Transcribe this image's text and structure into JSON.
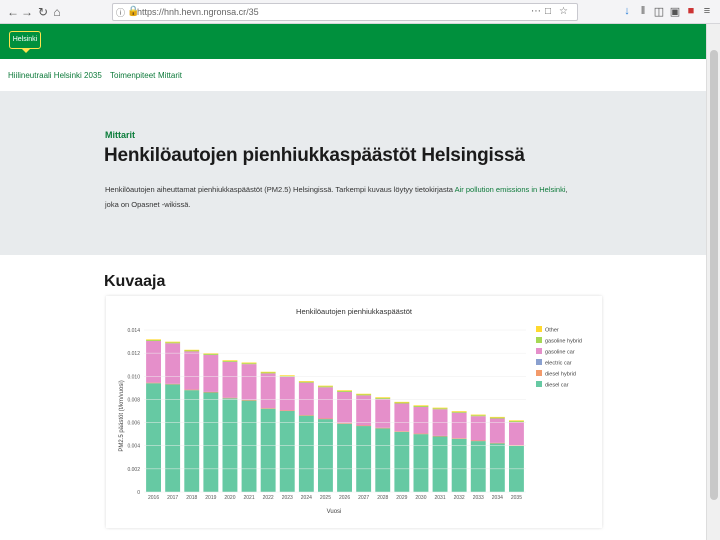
{
  "browser": {
    "url": "https://hnh.hevn.ngronsa.cr/35",
    "back_icon": "arrow-left",
    "forward_icon": "arrow-right",
    "reload_icon": "reload",
    "home_icon": "home"
  },
  "header": {
    "logo_text": "Helsinki",
    "brand_color": "#00903d",
    "logo_color": "#ffe34d"
  },
  "subnav": {
    "items": [
      "Hiilineutraali Helsinki 2035",
      "Toimenpiteet",
      "Mittarit"
    ]
  },
  "hero": {
    "eyebrow": "Mittarit",
    "title": "Henkilöautojen pienhiukkaspäästöt Helsingissä",
    "lead_before": "Henkilöautojen aiheuttamat pienhiukkaspäästöt (PM2.5) Helsingissä. Tarkempi kuvaus löytyy tietokirjasta ",
    "lead_link": "Air pollution emissions in Helsinki",
    "lead_after": ", joka on Opasnet -wikissä."
  },
  "section": {
    "title": "Kuvaaja"
  },
  "chart_data": {
    "type": "bar",
    "title": "Henkilöautojen pienhiukkaspäästöt",
    "xlabel": "Vuosi",
    "ylabel": "PM2.5 päästöt (t/km/vuosi)",
    "ylim": [
      0,
      0.014
    ],
    "yticks": [
      "0",
      "0.002",
      "0.004",
      "0.006",
      "0.008",
      "0.010",
      "0.012",
      "0.014"
    ],
    "categories": [
      "2016",
      "2017",
      "2018",
      "2019",
      "2020",
      "2021",
      "2022",
      "2023",
      "2024",
      "2025",
      "2026",
      "2027",
      "2028",
      "2029",
      "2030",
      "2031",
      "2032",
      "2033",
      "2034",
      "2035"
    ],
    "legend_position": "right",
    "series": [
      {
        "name": "diesel car",
        "color": "#66c9a3",
        "values": [
          0.0094,
          0.0093,
          0.0088,
          0.0086,
          0.0081,
          0.0079,
          0.0072,
          0.007,
          0.0066,
          0.0063,
          0.0059,
          0.0057,
          0.0055,
          0.0052,
          0.005,
          0.0048,
          0.0046,
          0.0044,
          0.0042,
          0.004
        ]
      },
      {
        "name": "diesel hybrid",
        "color": "#f39a6a",
        "values": [
          5e-05,
          5e-05,
          5e-05,
          5e-05,
          5e-05,
          5e-05,
          5e-05,
          5e-05,
          5e-05,
          5e-05,
          5e-05,
          5e-05,
          5e-05,
          5e-05,
          5e-05,
          5e-05,
          5e-05,
          5e-05,
          5e-05,
          5e-05
        ]
      },
      {
        "name": "electric car",
        "color": "#8aa0cf",
        "values": [
          0,
          0,
          0,
          0,
          0,
          0,
          0,
          0,
          0,
          0,
          0,
          0,
          0,
          0,
          0,
          0,
          0,
          0,
          0,
          0
        ]
      },
      {
        "name": "gasoline car",
        "color": "#e58fca",
        "values": [
          0.0036,
          0.0035,
          0.0033,
          0.0032,
          0.0031,
          0.0031,
          0.003,
          0.0029,
          0.0028,
          0.0027,
          0.0027,
          0.0026,
          0.0025,
          0.0024,
          0.0023,
          0.0023,
          0.0022,
          0.0021,
          0.0021,
          0.002
        ]
      },
      {
        "name": "gasoline hybrid",
        "color": "#a6d854",
        "values": [
          8e-05,
          8e-05,
          8e-05,
          8e-05,
          8e-05,
          8e-05,
          8e-05,
          8e-05,
          8e-05,
          8e-05,
          8e-05,
          8e-05,
          8e-05,
          8e-05,
          8e-05,
          8e-05,
          8e-05,
          8e-05,
          8e-05,
          8e-05
        ]
      },
      {
        "name": "Other",
        "color": "#ffd92f",
        "values": [
          6e-05,
          6e-05,
          6e-05,
          6e-05,
          6e-05,
          6e-05,
          6e-05,
          6e-05,
          6e-05,
          6e-05,
          6e-05,
          6e-05,
          6e-05,
          6e-05,
          6e-05,
          6e-05,
          6e-05,
          6e-05,
          6e-05,
          6e-05
        ]
      }
    ]
  }
}
